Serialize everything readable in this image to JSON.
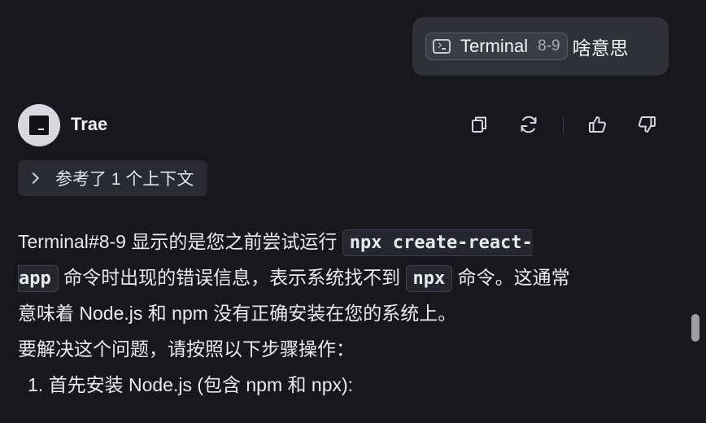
{
  "user_message": {
    "context_chip": {
      "icon": "terminal-icon",
      "label": "Terminal",
      "range": "8-9"
    },
    "text": "啥意思"
  },
  "assistant": {
    "avatar_icon": "trae-logo-icon",
    "name": "Trae",
    "actions": {
      "copy": "copy-icon",
      "regenerate": "refresh-icon",
      "like": "thumbs-up-icon",
      "dislike": "thumbs-down-icon"
    },
    "references": {
      "label": "参考了 1 个上下文"
    },
    "body": {
      "l1_text": "Terminal#8-9 显示的是您之前尝试运行 ",
      "l1_code": "npx create-react-",
      "l2_code": "app",
      "l2_text1": " 命令时出现的错误信息，表示系统找不到 ",
      "l2_code2": "npx",
      "l2_text2": " 命令。这通常",
      "l3_text": "意味着 Node.js 和 npm 没有正确安装在您的系统上。",
      "l4_text": "要解决这个问题，请按照以下步骤操作：",
      "list_item_1": "1. 首先安装 Node.js (包含 npm 和 npx):"
    }
  },
  "colors": {
    "background": "#18181c",
    "bubble": "#2f3038",
    "code_bg": "#26272e",
    "text": "#e9e9ee"
  }
}
